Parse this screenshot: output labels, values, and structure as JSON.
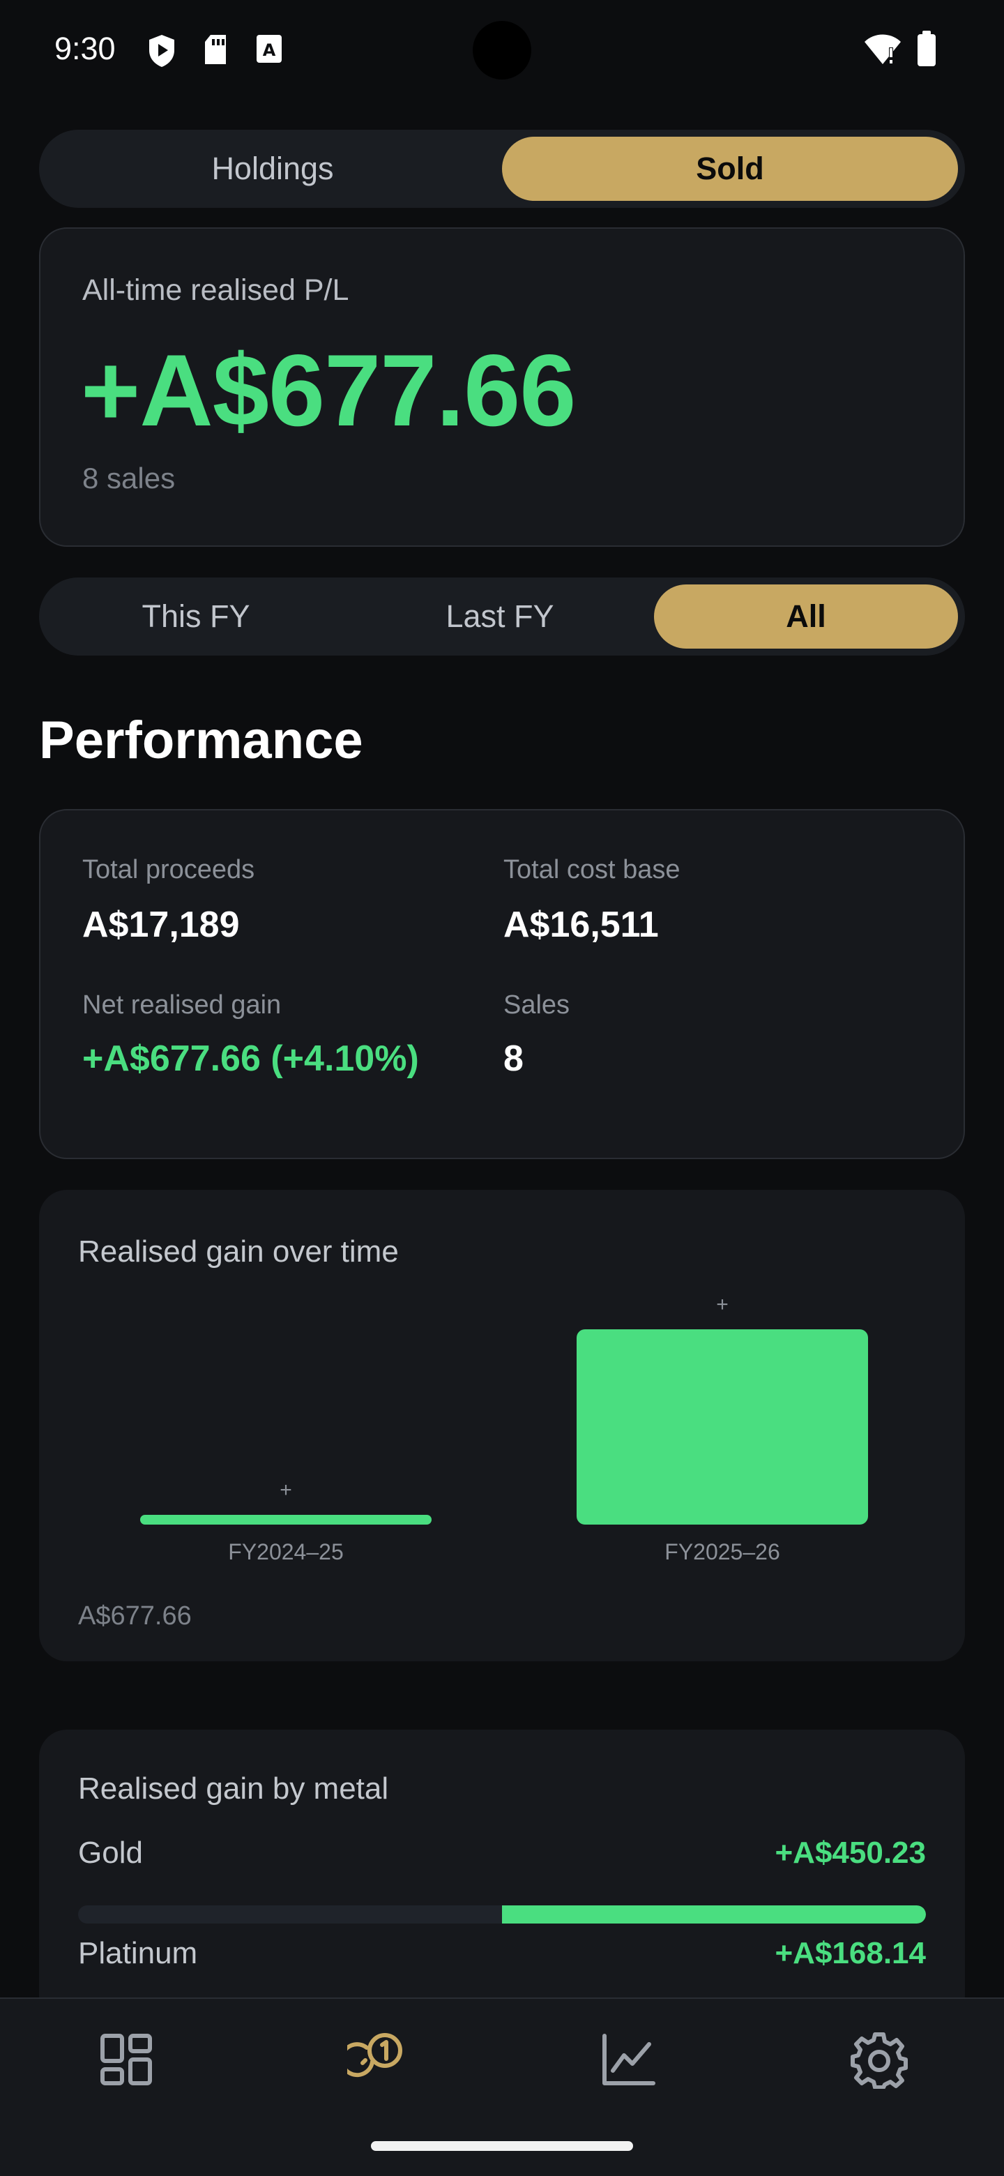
{
  "status_bar": {
    "time": "9:30",
    "icons": [
      "shield-play-icon",
      "sd-card-icon",
      "font-a-icon",
      "wifi-alert-icon",
      "battery-icon"
    ]
  },
  "view_toggle": {
    "options": [
      "Holdings",
      "Sold"
    ],
    "selected": "Sold"
  },
  "summary": {
    "label": "All-time realised P/L",
    "value": "+A$677.66",
    "sales_count": "8 sales"
  },
  "period_toggle": {
    "options": [
      "This FY",
      "Last FY",
      "All"
    ],
    "selected": "All"
  },
  "performance": {
    "title": "Performance",
    "stats": [
      {
        "label": "Total proceeds",
        "value": "A$17,189"
      },
      {
        "label": "Total cost base",
        "value": "A$16,511"
      },
      {
        "label": "Net realised gain",
        "value": "+A$677.66 (+4.10%)"
      },
      {
        "label": "Sales",
        "value": "8"
      }
    ]
  },
  "gain_chart": {
    "title": "Realised gain over time",
    "total_label": "A$677.66",
    "bar_color": "#4ade80",
    "chart_data": {
      "type": "bar",
      "categories": [
        "FY2024–25",
        "FY2025–26"
      ],
      "values": [
        9,
        677.66
      ],
      "data_labels": [
        "+",
        "+"
      ],
      "title": "Realised gain over time",
      "xlabel": "",
      "ylabel": "",
      "ylim": [
        0,
        677.66
      ]
    }
  },
  "metal_breakdown": {
    "title": "Realised gain by metal",
    "items": [
      {
        "name": "Gold",
        "value": "+A$450.23",
        "fraction": 0.5
      },
      {
        "name": "Platinum",
        "value": "+A$168.14"
      }
    ]
  },
  "bottom_nav": {
    "items": [
      "dashboard-icon",
      "coins-icon",
      "chart-line-icon",
      "settings-gear-icon"
    ],
    "active": "coins-icon",
    "accent_color": "#c8a862"
  }
}
